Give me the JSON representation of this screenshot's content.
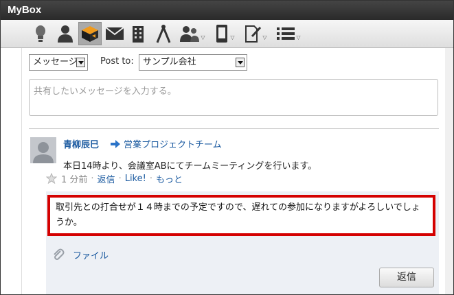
{
  "window": {
    "title": "MyBox"
  },
  "toolbar": {
    "items": [
      {
        "icon": "lightbulb-icon"
      },
      {
        "icon": "user-icon"
      },
      {
        "icon": "mybox-icon",
        "active": true
      },
      {
        "icon": "mail-icon"
      },
      {
        "icon": "building-icon"
      },
      {
        "icon": "compass-icon"
      },
      {
        "icon": "group-icon",
        "dropdown": true
      },
      {
        "icon": "phone-icon",
        "dropdown": true
      },
      {
        "icon": "pen-document-icon",
        "dropdown": true
      },
      {
        "icon": "list-icon",
        "dropdown": true
      }
    ]
  },
  "composer": {
    "type_select": "メッセージ",
    "post_to_label": "Post to:",
    "post_to_select": "サンプル会社",
    "placeholder": "共有したいメッセージを入力する。"
  },
  "post": {
    "author": "青柳辰巳",
    "target": "営業プロジェクトチーム",
    "text": "本日14時より、会議室ABにてチームミーティングを行います。",
    "time": "1 分前",
    "actions": {
      "reply": "返信",
      "like": "Like!",
      "more": "もっと"
    },
    "separator": "·"
  },
  "reply": {
    "text": "取引先との打合せが１４時までの予定ですので、遅れての参加になりますがよろしいでしょうか。",
    "file_label": "ファイル",
    "submit_label": "返信"
  },
  "colors": {
    "highlight": "#d40000",
    "link": "#1b5aa0",
    "titlebar": "#333333"
  }
}
